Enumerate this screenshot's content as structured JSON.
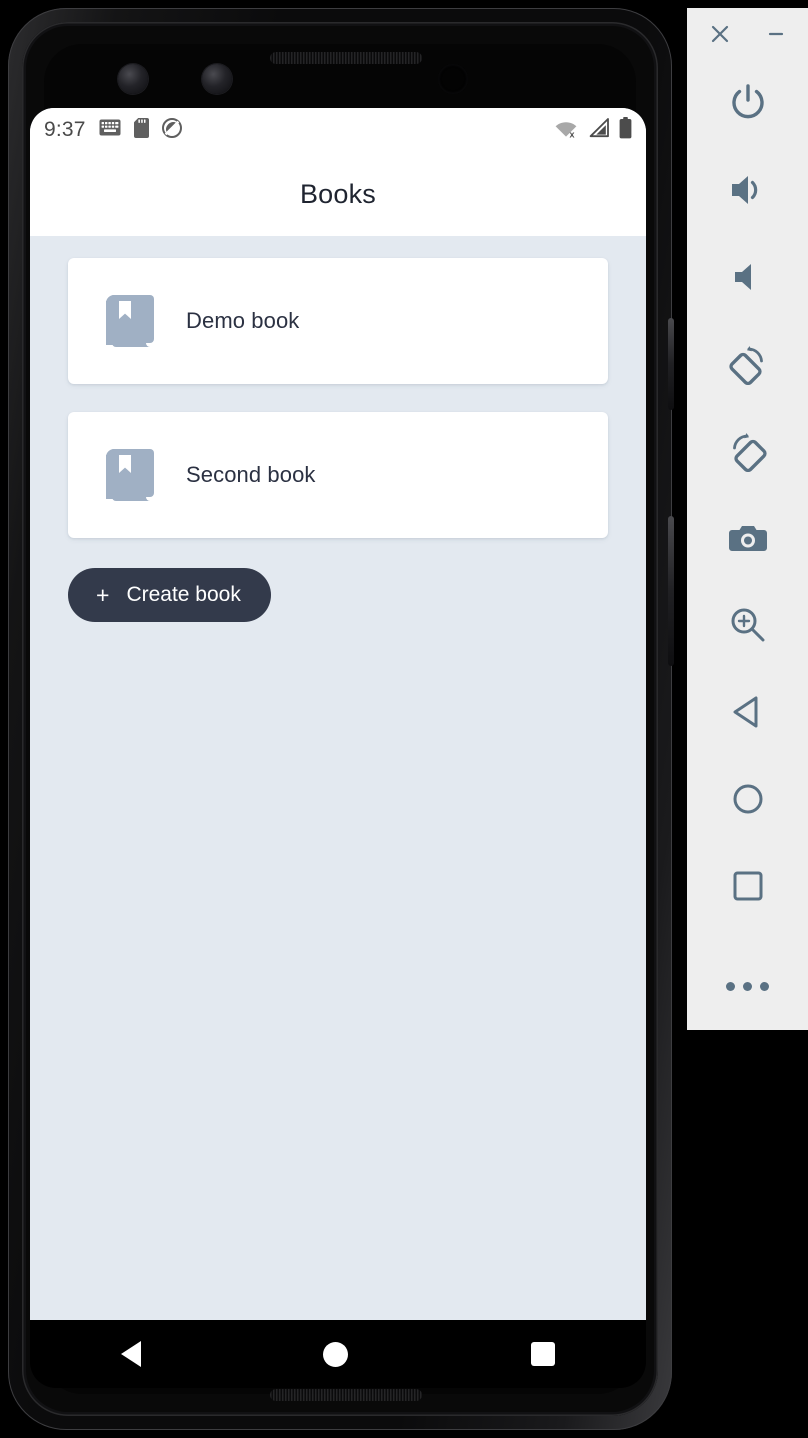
{
  "emulator": {
    "window_controls": [
      {
        "name": "close",
        "glyph": "✕"
      },
      {
        "name": "minimize",
        "glyph": "–"
      }
    ],
    "tools": [
      {
        "name": "power",
        "label": "Power"
      },
      {
        "name": "volume-up",
        "label": "Volume Up"
      },
      {
        "name": "volume-down",
        "label": "Volume Down"
      },
      {
        "name": "rotate-left",
        "label": "Rotate Left"
      },
      {
        "name": "rotate-right",
        "label": "Rotate Right"
      },
      {
        "name": "screenshot",
        "label": "Take Screenshot"
      },
      {
        "name": "zoom",
        "label": "Enter Zoom Mode"
      },
      {
        "name": "back",
        "label": "Back"
      },
      {
        "name": "home",
        "label": "Home"
      },
      {
        "name": "overview",
        "label": "Overview"
      },
      {
        "name": "more",
        "label": "More"
      }
    ],
    "icon_color": "#5a7183",
    "panel_color": "#eeeeee"
  },
  "phone": {
    "status_bar": {
      "time": "9:37",
      "left_icons": [
        "keyboard-icon",
        "sd-card-icon",
        "do-not-disturb-icon"
      ],
      "right_icons": [
        "wifi-off-icon",
        "cellular-signal-icon",
        "battery-icon"
      ]
    },
    "app_bar": {
      "title": "Books"
    },
    "main": {
      "background_color": "#e3e9f0",
      "books": [
        {
          "title": "Demo book",
          "icon": "book-icon"
        },
        {
          "title": "Second book",
          "icon": "book-icon"
        }
      ],
      "create_button": {
        "plus": "+",
        "label": "Create book",
        "color": "#333a4b"
      }
    },
    "nav_bar": {
      "items": [
        "back",
        "home",
        "recents"
      ]
    }
  }
}
